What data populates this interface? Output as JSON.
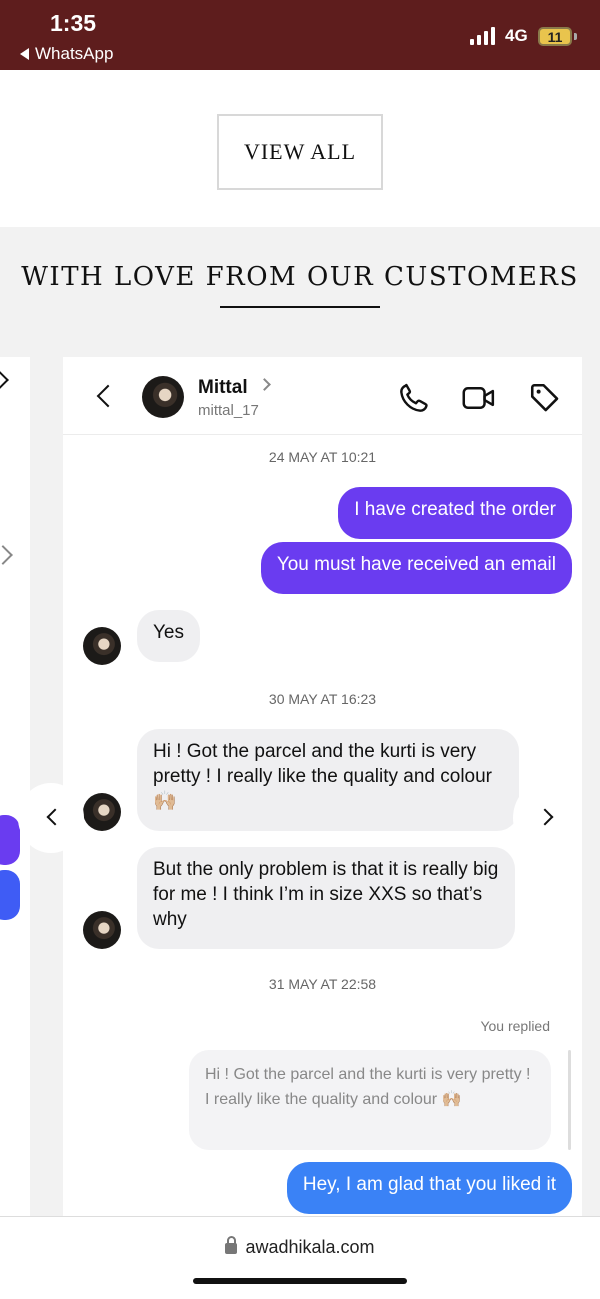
{
  "status_bar": {
    "time": "1:35",
    "back_app": "WhatsApp",
    "network": "4G",
    "battery": "11"
  },
  "view_all": "VIEW ALL",
  "section_title": "WITH LOVE FROM OUR CUSTOMERS",
  "chat": {
    "contact_name": "Mittal",
    "contact_username": "mittal_17",
    "messages": [
      {
        "type": "timestamp",
        "text": "24 MAY AT 10:21"
      },
      {
        "type": "outgoing",
        "text": "I have created the order"
      },
      {
        "type": "outgoing",
        "text": "You must have received an email"
      },
      {
        "type": "incoming",
        "text": "Yes"
      },
      {
        "type": "timestamp",
        "text": "30 MAY AT 16:23"
      },
      {
        "type": "incoming",
        "text": "Hi ! Got the parcel and the kurti is very pretty ! I really like the quality and colour 🙌🏼"
      },
      {
        "type": "incoming",
        "text": "But the only problem is that it is really big for me ! I think I’m in size XXS so that’s why"
      },
      {
        "type": "timestamp",
        "text": "31 MAY AT 22:58"
      },
      {
        "type": "replied_label",
        "text": "You replied"
      },
      {
        "type": "quote",
        "text": "Hi ! Got the parcel and the kurti is very pretty ! I really like the quality and colour 🙌🏼"
      },
      {
        "type": "outgoing",
        "text": "Hey, I am glad that you liked it"
      }
    ]
  },
  "browser": {
    "url": "awadhikala.com"
  },
  "colors": {
    "status_bar_bg": "#5e1d1d",
    "outgoing_purple": "#6a3cf0",
    "outgoing_blue": "#3a82f6",
    "incoming_bg": "#efeff1"
  }
}
